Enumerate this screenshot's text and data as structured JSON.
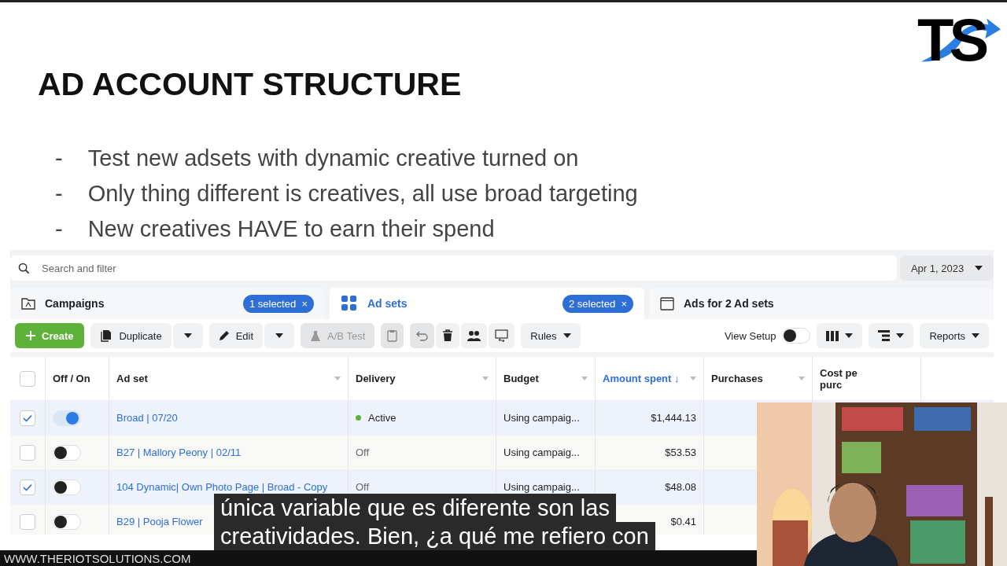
{
  "logo": {
    "text": "TS"
  },
  "slide": {
    "title": "AD ACCOUNT STRUCTURE",
    "bullets": [
      {
        "marker": "-",
        "text": "Test new adsets with dynamic creative turned on"
      },
      {
        "marker": "-",
        "text": "Only thing different is creatives, all use broad targeting"
      },
      {
        "marker": "-",
        "text": "New creatives HAVE to earn their spend"
      }
    ]
  },
  "ads_manager": {
    "search": {
      "placeholder": "Search and filter"
    },
    "date_button": {
      "label": "Apr 1, 2023"
    },
    "tabs": [
      {
        "label": "Campaigns",
        "kind": "folder",
        "badge": "1 selected",
        "badge_close": "×",
        "selected": false
      },
      {
        "label": "Ad sets",
        "kind": "grid",
        "badge": "2 selected",
        "badge_close": "×",
        "selected": true
      },
      {
        "label": "Ads for 2 Ad sets",
        "kind": "window",
        "selected": false
      }
    ],
    "toolbar": {
      "create": "Create",
      "duplicate": "Duplicate",
      "edit": "Edit",
      "ab_test": {
        "label": "A/B Test",
        "disabled": true
      },
      "rules": "Rules",
      "view_setup": {
        "label": "View Setup",
        "on": false
      },
      "reports": "Reports"
    },
    "table": {
      "columns": [
        {
          "label": "Off / On",
          "sortable": false,
          "sorted": false
        },
        {
          "label": "Ad set",
          "sortable": true,
          "sorted": false
        },
        {
          "label": "Delivery",
          "sortable": true,
          "sorted": false
        },
        {
          "label": "Budget",
          "sortable": true,
          "sorted": false
        },
        {
          "label": "Amount spent ↓",
          "sortable": true,
          "sorted": true
        },
        {
          "label": "Purchases",
          "sortable": true,
          "sorted": false
        },
        {
          "label": "Cost pe purc",
          "sortable": false,
          "sorted": false
        }
      ],
      "all_checked": false,
      "rows": [
        {
          "checked": true,
          "on": true,
          "name": "Broad | 07/20",
          "delivery": "Active",
          "active": true,
          "budget": "Using campaig...",
          "amount": "$1,444.13"
        },
        {
          "checked": false,
          "on": false,
          "name": "B27 | Mallory Peony | 02/11",
          "delivery": "Off",
          "active": false,
          "budget": "Using campaig...",
          "amount": "$53.53"
        },
        {
          "checked": true,
          "on": false,
          "name": "104 Dynamic| Own Photo Page | Broad - Copy",
          "delivery": "Off",
          "active": false,
          "budget": "Using campaig...",
          "amount": "$48.08"
        },
        {
          "checked": false,
          "on": false,
          "name": "B29 | Pooja Flower",
          "amount": "$0.41"
        }
      ]
    }
  },
  "webcam": {
    "kind": "picture"
  },
  "subtitles": [
    "única variable que es diferente son las",
    "creatividades. Bien, ¿a qué me refiero con"
  ],
  "footer": {
    "url": "WWW.THERIOTSOLUTIONS.COM"
  }
}
